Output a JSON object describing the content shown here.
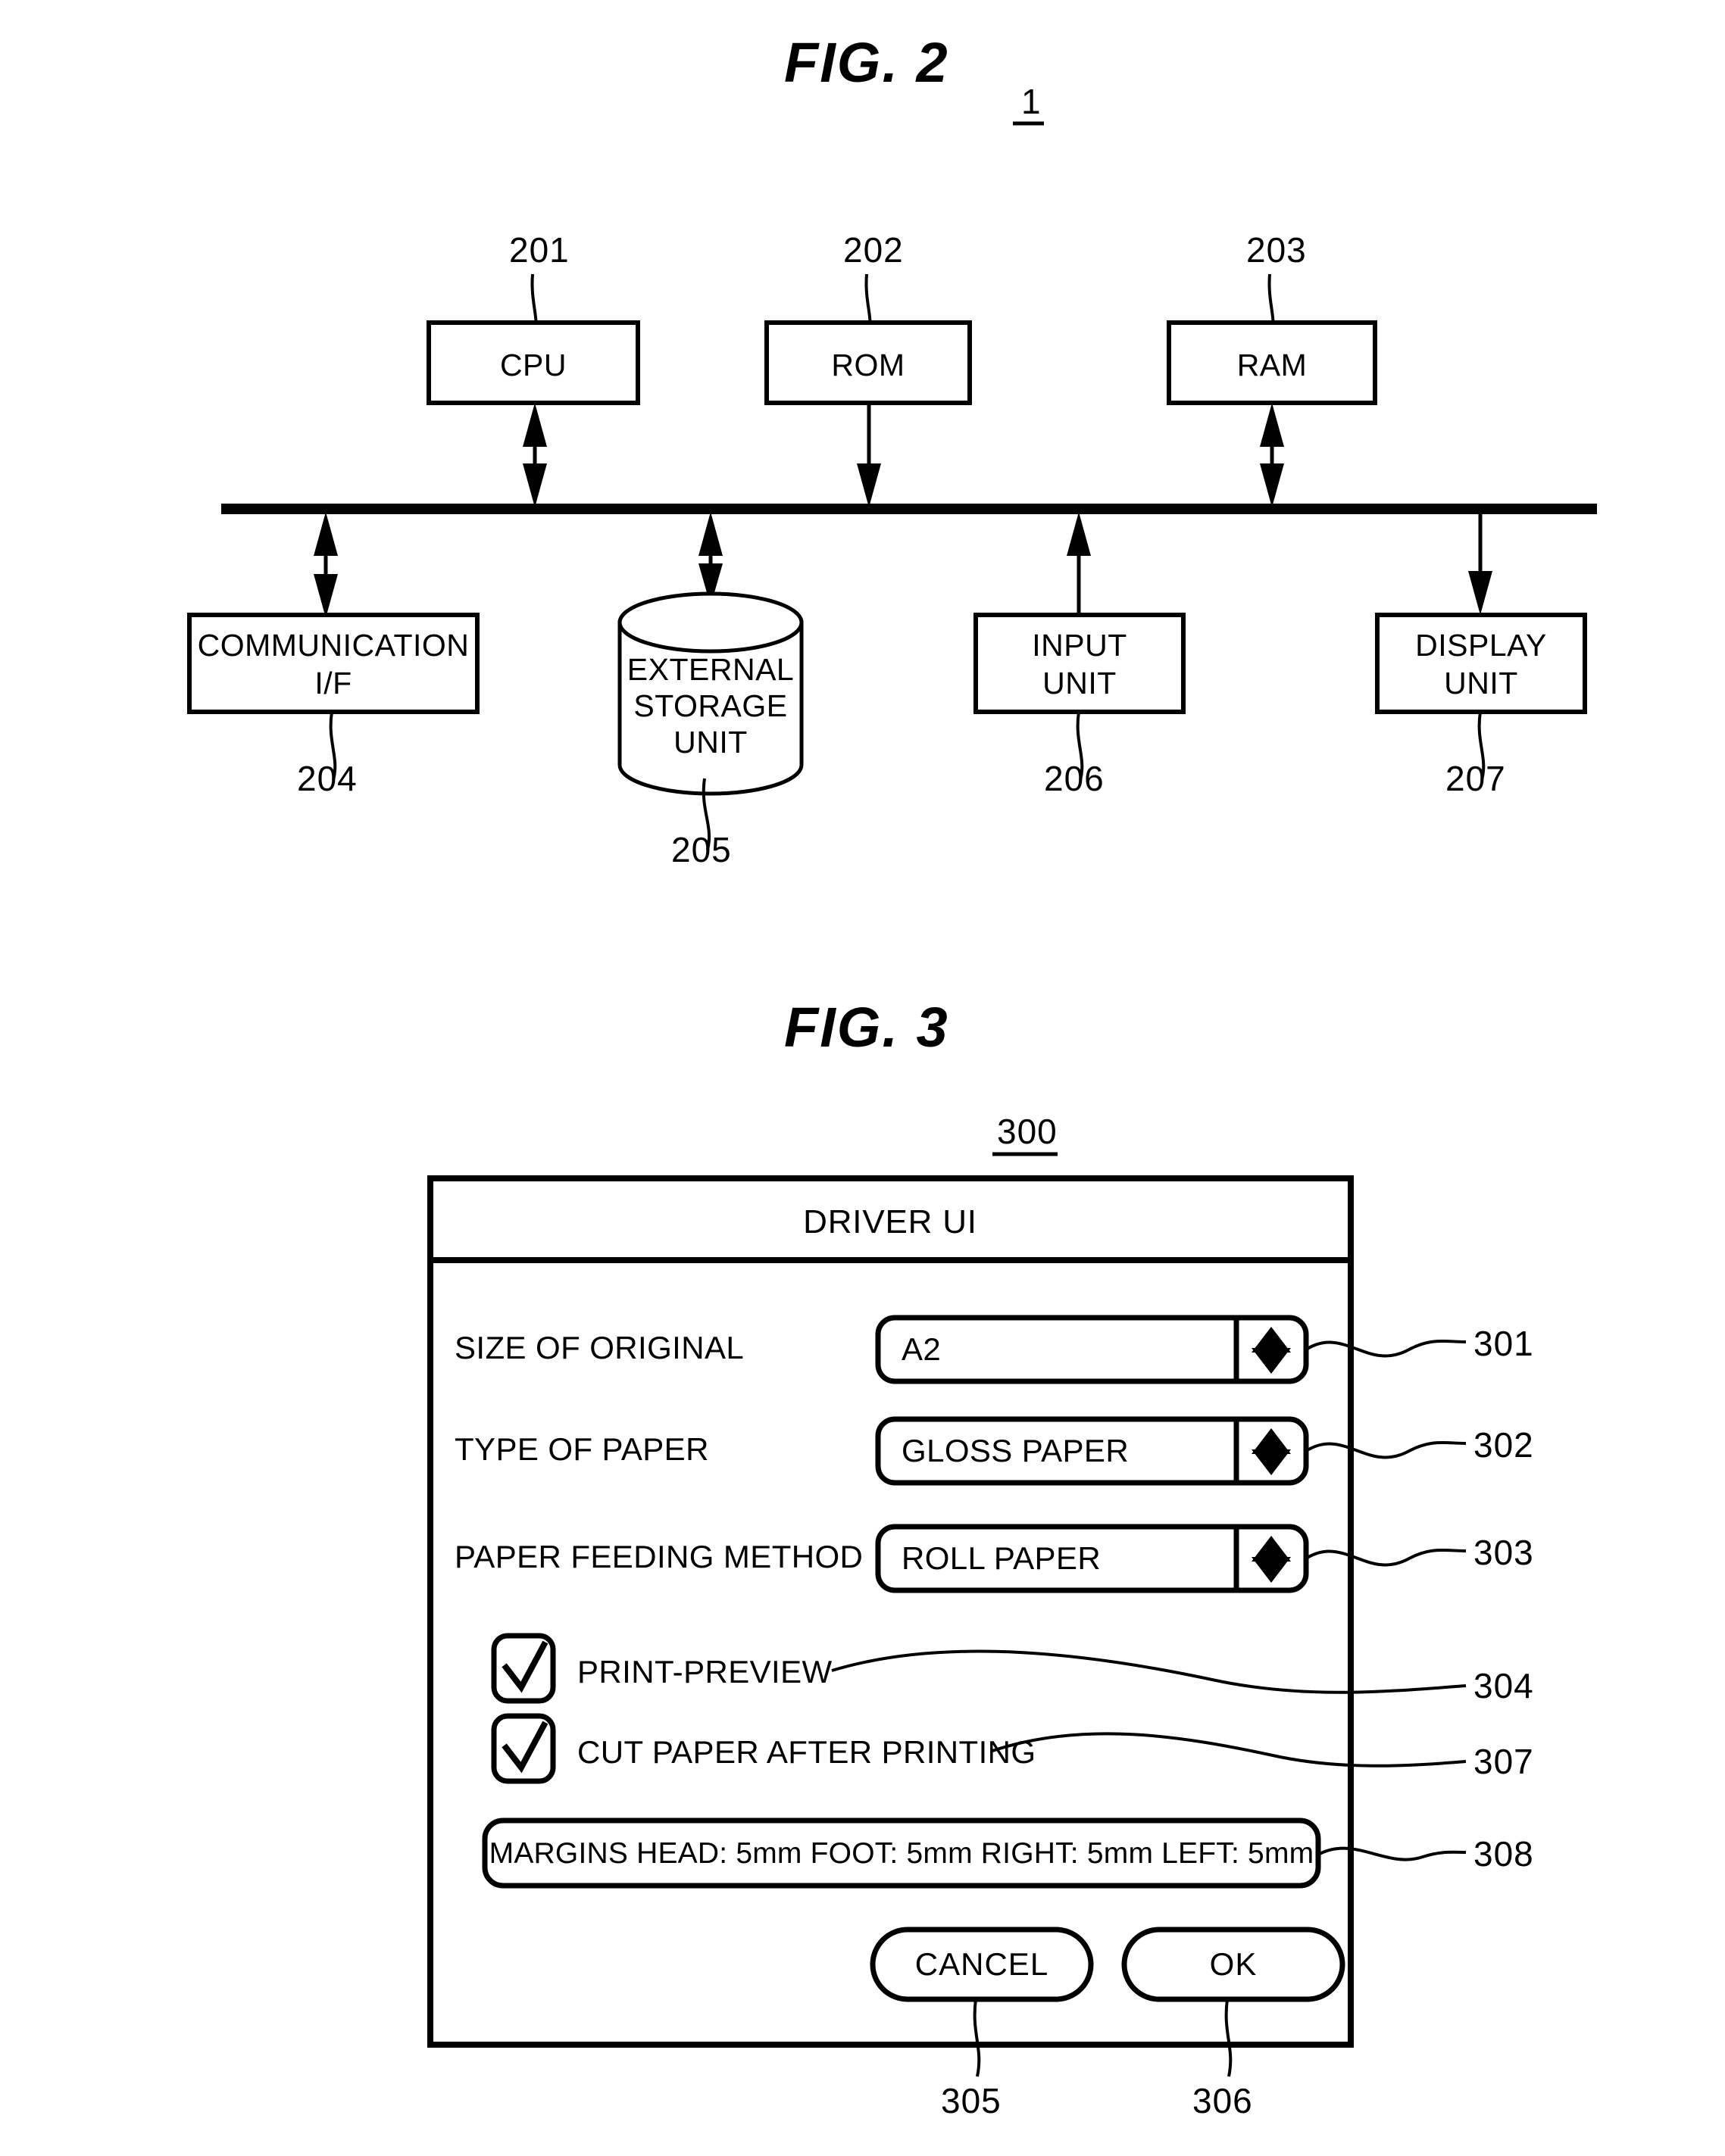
{
  "figures": [
    {
      "title": "FIG.  2",
      "system_ref": "1",
      "blocks": [
        {
          "id": "cpu",
          "label": "CPU",
          "ref": "201"
        },
        {
          "id": "rom",
          "label": "ROM",
          "ref": "202"
        },
        {
          "id": "ram",
          "label": "RAM",
          "ref": "203"
        },
        {
          "id": "communication",
          "label_line1": "COMMUNICATION",
          "label_line2": "I/F",
          "ref": "204"
        },
        {
          "id": "storage",
          "label_line1": "EXTERNAL",
          "label_line2": "STORAGE",
          "label_line3": "UNIT",
          "ref": "205"
        },
        {
          "id": "input",
          "label_line1": "INPUT",
          "label_line2": "UNIT",
          "ref": "206"
        },
        {
          "id": "display",
          "label_line1": "DISPLAY",
          "label_line2": "UNIT",
          "ref": "207"
        }
      ]
    },
    {
      "title": "FIG.  3",
      "dialog_ref": "300",
      "dialog": {
        "title": "DRIVER UI",
        "fields": [
          {
            "label": "SIZE OF ORIGINAL",
            "value": "A2",
            "ref": "301"
          },
          {
            "label": "TYPE OF PAPER",
            "value": "GLOSS PAPER",
            "ref": "302"
          },
          {
            "label": "PAPER FEEDING METHOD",
            "value": "ROLL PAPER",
            "ref": "303"
          }
        ],
        "checkboxes": [
          {
            "label": "PRINT-PREVIEW",
            "checked": true,
            "ref": "304"
          },
          {
            "label": "CUT PAPER AFTER PRINTING",
            "checked": true,
            "ref": "307"
          }
        ],
        "margins_bar": {
          "text": "MARGINS  HEAD: 5mm  FOOT: 5mm  RIGHT: 5mm  LEFT: 5mm",
          "ref": "308"
        },
        "buttons": [
          {
            "label": "CANCEL",
            "ref": "305"
          },
          {
            "label": "OK",
            "ref": "306"
          }
        ]
      }
    }
  ],
  "colors": {
    "ink": "#000000",
    "paper": "#ffffff"
  }
}
